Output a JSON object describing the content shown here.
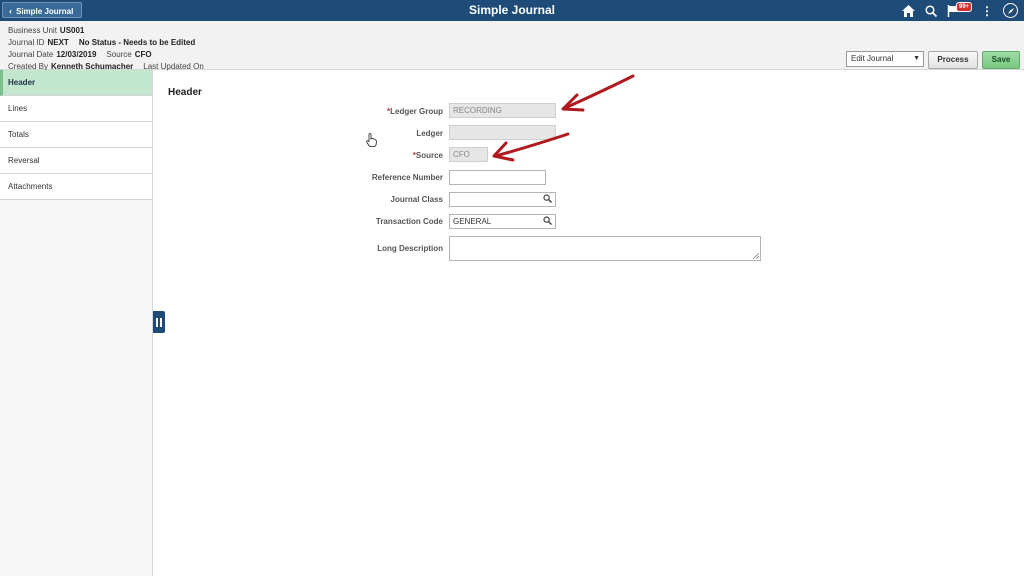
{
  "topbar": {
    "back_label": "Simple Journal",
    "title": "Simple Journal",
    "notification_count": "99+",
    "icons": [
      "home-icon",
      "search-icon",
      "notification-flag-icon",
      "more-options-icon",
      "navbar-compass-icon"
    ]
  },
  "info": {
    "business_unit_label": "Business Unit",
    "business_unit_value": "US001",
    "journal_id_label": "Journal ID",
    "journal_id_value": "NEXT",
    "status_value": "No Status - Needs to be Edited",
    "journal_date_label": "Journal Date",
    "journal_date_value": "12/03/2019",
    "source_label": "Source",
    "source_value": "CFO",
    "created_by_label": "Created By",
    "created_by_value": "Kenneth Schumacher",
    "last_updated_label": "Last Updated On"
  },
  "actions": {
    "select_value": "Edit Journal",
    "process_label": "Process",
    "save_label": "Save"
  },
  "sidebar": {
    "items": [
      {
        "label": "Header",
        "active": true
      },
      {
        "label": "Lines"
      },
      {
        "label": "Totals"
      },
      {
        "label": "Reversal"
      },
      {
        "label": "Attachments"
      }
    ]
  },
  "header_section": {
    "title": "Header",
    "fields": {
      "ledger_group": {
        "label": "Ledger Group",
        "required": true,
        "value": "RECORDING"
      },
      "ledger": {
        "label": "Ledger",
        "value": ""
      },
      "source": {
        "label": "Source",
        "required": true,
        "value": "CFO"
      },
      "reference_number": {
        "label": "Reference Number",
        "value": ""
      },
      "journal_class": {
        "label": "Journal Class",
        "value": ""
      },
      "transaction_code": {
        "label": "Transaction Code",
        "value": "GENERAL"
      },
      "long_description": {
        "label": "Long Description",
        "value": ""
      }
    },
    "required_marker": "*"
  },
  "colors": {
    "banner": "#1f4b78",
    "active_tab": "#c3e6cf",
    "save": "#78c883",
    "annotation": "#b0191e"
  }
}
